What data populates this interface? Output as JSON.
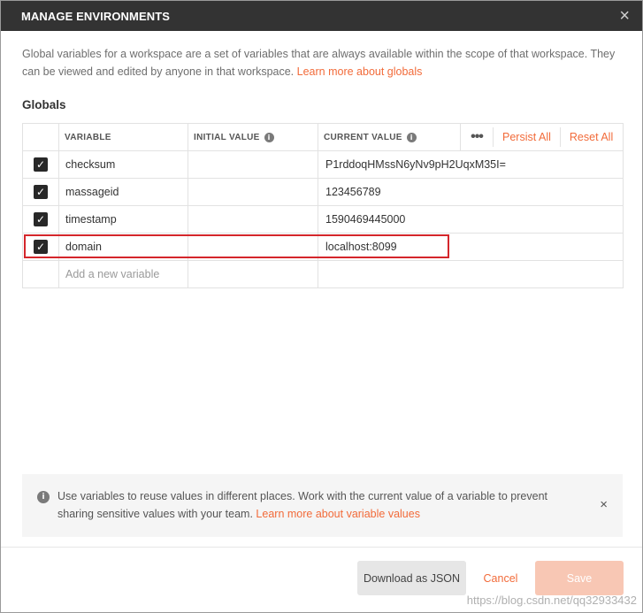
{
  "modal": {
    "title": "MANAGE ENVIRONMENTS",
    "close_icon": "×"
  },
  "description": {
    "text": "Global variables for a workspace are a set of variables that are always available within the scope of that workspace. They can be viewed and edited by anyone in that workspace.",
    "link": "Learn more about globals"
  },
  "section_title": "Globals",
  "table": {
    "headers": {
      "variable": "VARIABLE",
      "initial_value": "INITIAL VALUE",
      "current_value": "CURRENT VALUE",
      "info_icon": "i",
      "more": "•••",
      "persist_all": "Persist All",
      "reset_all": "Reset All"
    },
    "rows": [
      {
        "checked": true,
        "variable": "checksum",
        "initial": "",
        "current": "P1rddoqHMssN6yNv9pH2UqxM35I="
      },
      {
        "checked": true,
        "variable": "massageid",
        "initial": "",
        "current": "123456789"
      },
      {
        "checked": true,
        "variable": "timestamp",
        "initial": "",
        "current": "1590469445000"
      },
      {
        "checked": true,
        "variable": "domain",
        "initial": "",
        "current": "localhost:8099"
      }
    ],
    "new_placeholder": "Add a new variable",
    "checkmark": "✓"
  },
  "tip": {
    "icon": "i",
    "text": "Use variables to reuse values in different places. Work with the current value of a variable to prevent sharing sensitive values with your team.",
    "link": "Learn more about variable values",
    "close": "×"
  },
  "footer": {
    "download": "Download as JSON",
    "cancel": "Cancel",
    "save": "Save"
  },
  "watermark": "https://blog.csdn.net/qq32933432",
  "colors": {
    "accent": "#f26b3a",
    "header_bg": "#333333",
    "highlight": "#d4262b"
  }
}
